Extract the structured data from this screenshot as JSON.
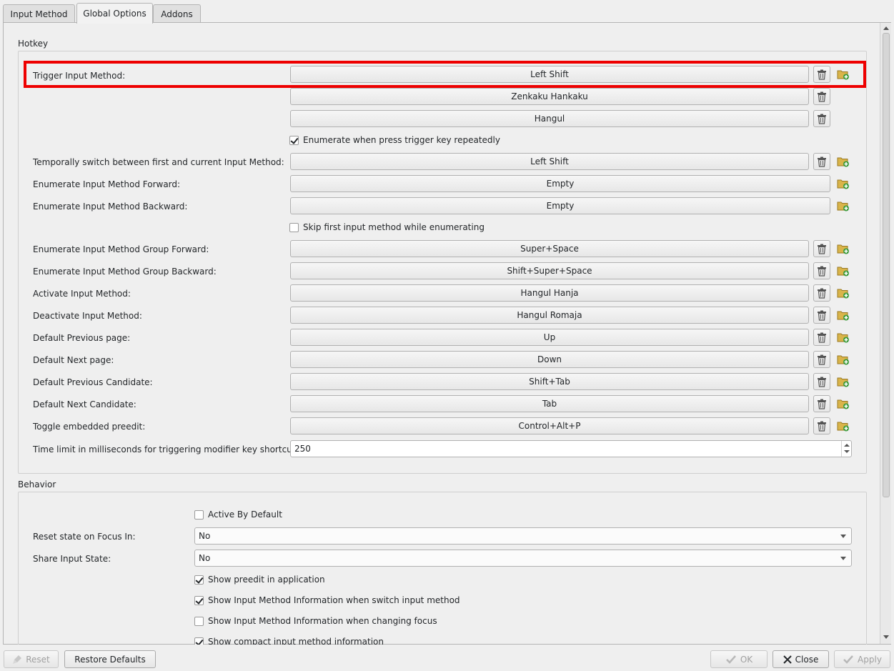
{
  "tabs": [
    {
      "label": "Input Method",
      "active": false
    },
    {
      "label": "Global Options",
      "active": true
    },
    {
      "label": "Addons",
      "active": false
    }
  ],
  "hotkey": {
    "title": "Hotkey",
    "trigger_label": "Trigger Input Method:",
    "trigger_keys": [
      "Left Shift",
      "Zenkaku Hankaku",
      "Hangul"
    ],
    "enumerate_check": {
      "label": "Enumerate when press trigger key repeatedly",
      "checked": true
    },
    "temp_switch": {
      "label": "Temporally switch between first and current Input Method:",
      "value": "Left Shift"
    },
    "enum_forward": {
      "label": "Enumerate Input Method Forward:",
      "value": "Empty"
    },
    "enum_backward": {
      "label": "Enumerate Input Method Backward:",
      "value": "Empty"
    },
    "skip_first_check": {
      "label": "Skip first input method while enumerating",
      "checked": false
    },
    "rows": [
      {
        "label": "Enumerate Input Method Group Forward:",
        "value": "Super+Space"
      },
      {
        "label": "Enumerate Input Method Group Backward:",
        "value": "Shift+Super+Space"
      },
      {
        "label": "Activate Input Method:",
        "value": "Hangul Hanja"
      },
      {
        "label": "Deactivate Input Method:",
        "value": "Hangul Romaja"
      },
      {
        "label": "Default Previous page:",
        "value": "Up"
      },
      {
        "label": "Default Next page:",
        "value": "Down"
      },
      {
        "label": "Default Previous Candidate:",
        "value": "Shift+Tab"
      },
      {
        "label": "Default Next Candidate:",
        "value": "Tab"
      },
      {
        "label": "Toggle embedded preedit:",
        "value": "Control+Alt+P"
      }
    ],
    "time_limit": {
      "label": "Time limit in milliseconds for triggering modifier key shortcuts:",
      "value": "250"
    }
  },
  "behavior": {
    "title": "Behavior",
    "active_by_default": {
      "label": "Active By Default",
      "checked": false
    },
    "reset_state": {
      "label": "Reset state on Focus In:",
      "value": "No"
    },
    "share_state": {
      "label": "Share Input State:",
      "value": "No"
    },
    "checks": [
      {
        "label": "Show preedit in application",
        "checked": true
      },
      {
        "label": "Show Input Method Information when switch input method",
        "checked": true
      },
      {
        "label": "Show Input Method Information when changing focus",
        "checked": false
      },
      {
        "label": "Show compact input method information",
        "checked": true
      }
    ]
  },
  "buttons": {
    "reset": "Reset",
    "restore_defaults": "Restore Defaults",
    "ok": "OK",
    "close": "Close",
    "apply": "Apply"
  },
  "icons": {
    "delete": "trash-icon",
    "add": "folder-add-icon",
    "highlight_color": "#ee0000"
  }
}
